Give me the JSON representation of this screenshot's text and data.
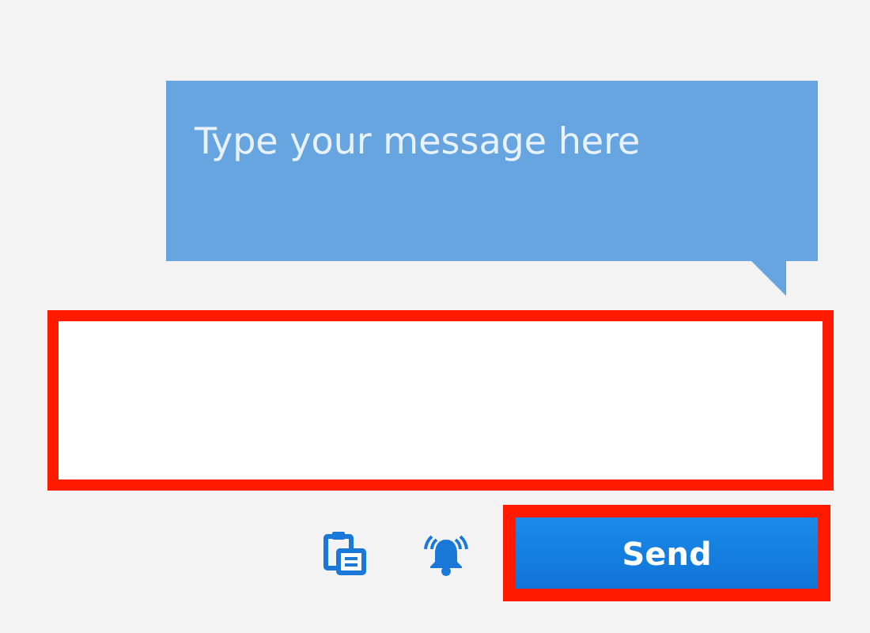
{
  "tooltip": {
    "text": "Type your message here"
  },
  "message_field": {
    "highlighted": true
  },
  "toolbar": [
    {
      "kind": "clipboard"
    },
    {
      "kind": "bell"
    }
  ],
  "send_button": {
    "label": "Send",
    "highlighted": true
  }
}
